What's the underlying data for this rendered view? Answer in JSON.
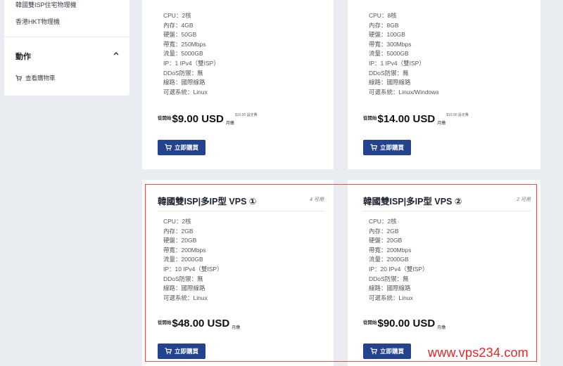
{
  "sidebar": {
    "links": [
      "韓國雙ISP住宅物理機",
      "香港HKT物理機"
    ],
    "actions_heading": "動作",
    "view_cart_label": "查看購物車"
  },
  "products": [
    {
      "specs": [
        "CPU：2核",
        "內存：4GB",
        "硬盤：50GB",
        "帶寬：250Mbps",
        "流量：5000GB",
        "IP：1 IPv4（雙ISP）",
        "DDoS防禦：無",
        "線路：國際線路",
        "可選系統：Linux"
      ],
      "price_prefix": "從開始",
      "price": "$9.00 USD",
      "period": "月繳",
      "setup_fee": "$10.00 設定費",
      "buy_label": "立即購買"
    },
    {
      "specs": [
        "CPU：8核",
        "內存：8GB",
        "硬盤：100GB",
        "帶寬：300Mbps",
        "流量：5000GB",
        "IP：1 IPv4（雙ISP）",
        "DDoS防禦：無",
        "線路：國際線路",
        "可選系統：Linux/Windows"
      ],
      "price_prefix": "從開始",
      "price": "$14.00 USD",
      "period": "月繳",
      "setup_fee": "$10.00 設定費",
      "buy_label": "立即購買"
    },
    {
      "title": "韓國雙ISP|多IP型 VPS ①",
      "availability": "4 可用",
      "specs": [
        "CPU：2核",
        "內存：2GB",
        "硬盤：20GB",
        "帶寬：200Mbps",
        "流量：2000GB",
        "IP：10 IPv4（雙ISP）",
        "DDoS防禦：無",
        "線路：國際線路",
        "可選系統：Linux"
      ],
      "price_prefix": "從開始",
      "price": "$48.00 USD",
      "period": "月繳",
      "buy_label": "立即購買"
    },
    {
      "title": "韓國雙ISP|多IP型 VPS ②",
      "availability": "2 可用",
      "specs": [
        "CPU：2核",
        "內存：2GB",
        "硬盤：20GB",
        "帶寬：200Mbps",
        "流量：2000GB",
        "IP：20 IPv4（雙ISP）",
        "DDoS防禦：無",
        "線路：國際線路",
        "可選系統：Linux"
      ],
      "price_prefix": "從開始",
      "price": "$90.00 USD",
      "period": "月繳",
      "buy_label": "立即購買"
    }
  ],
  "watermark": "www.vps234.com",
  "colors": {
    "button": "#23438f",
    "highlight": "#d9534f",
    "watermark": "#e32626",
    "background": "#e9ecf1"
  }
}
